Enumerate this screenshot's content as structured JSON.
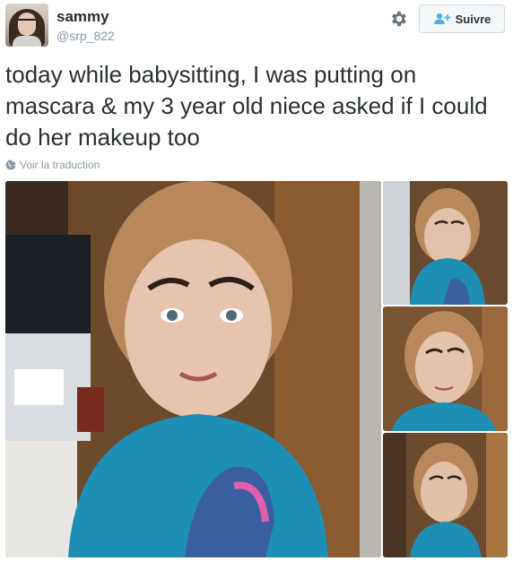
{
  "user": {
    "name": "sammy",
    "handle": "@srp_822"
  },
  "actions": {
    "follow_label": "Suivre"
  },
  "tweet": {
    "text": "today while babysitting, I was putting on mascara & my 3 year old niece asked if I could do her makeup too",
    "translate_label": "Voir la traduction"
  },
  "icons": {
    "gear": "gear-icon",
    "follow": "add-user-icon",
    "translate": "globe-icon"
  },
  "colors": {
    "text": "#292f33",
    "secondary": "#8899a6",
    "accent": "#55acee",
    "shirt": "#1e8fb4"
  }
}
